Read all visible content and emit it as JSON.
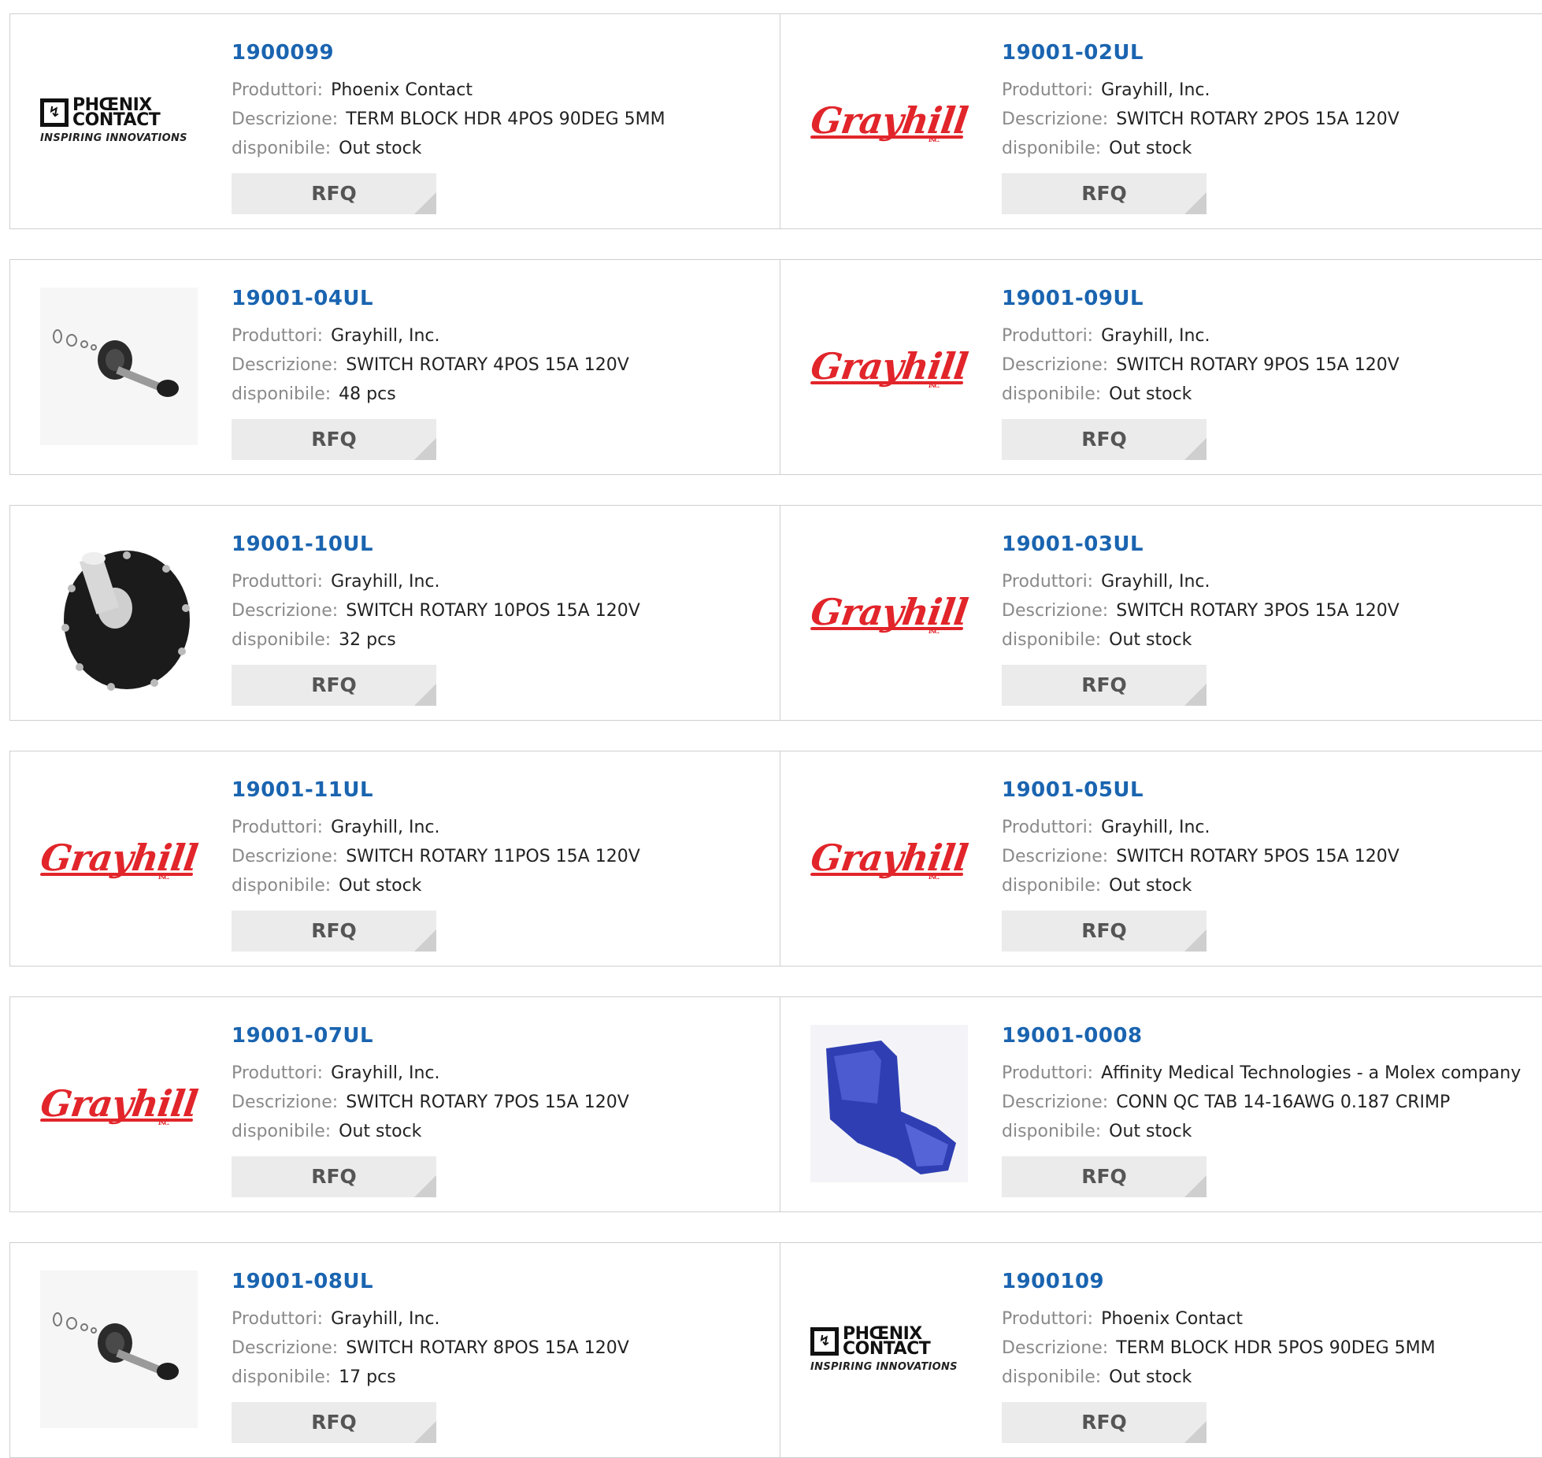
{
  "labels": {
    "manufacturer": "Produttori:",
    "description": "Descrizione:",
    "availability": "disponibile:",
    "rfq": "RFQ"
  },
  "logos": {
    "phoenix_line1": "PHŒNIX",
    "phoenix_line2": "CONTACT",
    "phoenix_tag": "INSPIRING INNOVATIONS",
    "grayhill": "Grayhill",
    "grayhill_inc": "INC."
  },
  "colors": {
    "part_link": "#1a64b0",
    "label": "#8a8a8a",
    "button_bg": "#ebebeb",
    "grayhill_red": "#e1252a",
    "connector_blue": "#2f3fb3"
  },
  "products": [
    {
      "part": "1900099",
      "manufacturer": "Phoenix Contact",
      "description": "TERM BLOCK HDR 4POS 90DEG 5MM",
      "availability": "Out stock",
      "image": "phoenix-contact-logo"
    },
    {
      "part": "19001-02UL",
      "manufacturer": "Grayhill, Inc.",
      "description": "SWITCH ROTARY 2POS 15A 120V",
      "availability": "Out stock",
      "image": "grayhill-logo"
    },
    {
      "part": "19001-04UL",
      "manufacturer": "Grayhill, Inc.",
      "description": "SWITCH ROTARY 4POS 15A 120V",
      "availability": "48 pcs",
      "image": "rotary-switch-exploded-photo"
    },
    {
      "part": "19001-09UL",
      "manufacturer": "Grayhill, Inc.",
      "description": "SWITCH ROTARY 9POS 15A 120V",
      "availability": "Out stock",
      "image": "grayhill-logo"
    },
    {
      "part": "19001-10UL",
      "manufacturer": "Grayhill, Inc.",
      "description": "SWITCH ROTARY 10POS 15A 120V",
      "availability": "32 pcs",
      "image": "rotary-switch-photo"
    },
    {
      "part": "19001-03UL",
      "manufacturer": "Grayhill, Inc.",
      "description": "SWITCH ROTARY 3POS 15A 120V",
      "availability": "Out stock",
      "image": "grayhill-logo"
    },
    {
      "part": "19001-11UL",
      "manufacturer": "Grayhill, Inc.",
      "description": "SWITCH ROTARY 11POS 15A 120V",
      "availability": "Out stock",
      "image": "grayhill-logo"
    },
    {
      "part": "19001-05UL",
      "manufacturer": "Grayhill, Inc.",
      "description": "SWITCH ROTARY 5POS 15A 120V",
      "availability": "Out stock",
      "image": "grayhill-logo"
    },
    {
      "part": "19001-07UL",
      "manufacturer": "Grayhill, Inc.",
      "description": "SWITCH ROTARY 7POS 15A 120V",
      "availability": "Out stock",
      "image": "grayhill-logo"
    },
    {
      "part": "19001-0008",
      "manufacturer": "Affinity Medical Technologies - a Molex company",
      "description": "CONN QC TAB 14-16AWG 0.187 CRIMP",
      "availability": "Out stock",
      "image": "blue-connector-photo"
    },
    {
      "part": "19001-08UL",
      "manufacturer": "Grayhill, Inc.",
      "description": "SWITCH ROTARY 8POS 15A 120V",
      "availability": "17 pcs",
      "image": "rotary-switch-exploded-photo"
    },
    {
      "part": "1900109",
      "manufacturer": "Phoenix Contact",
      "description": "TERM BLOCK HDR 5POS 90DEG 5MM",
      "availability": "Out stock",
      "image": "phoenix-contact-logo"
    }
  ]
}
